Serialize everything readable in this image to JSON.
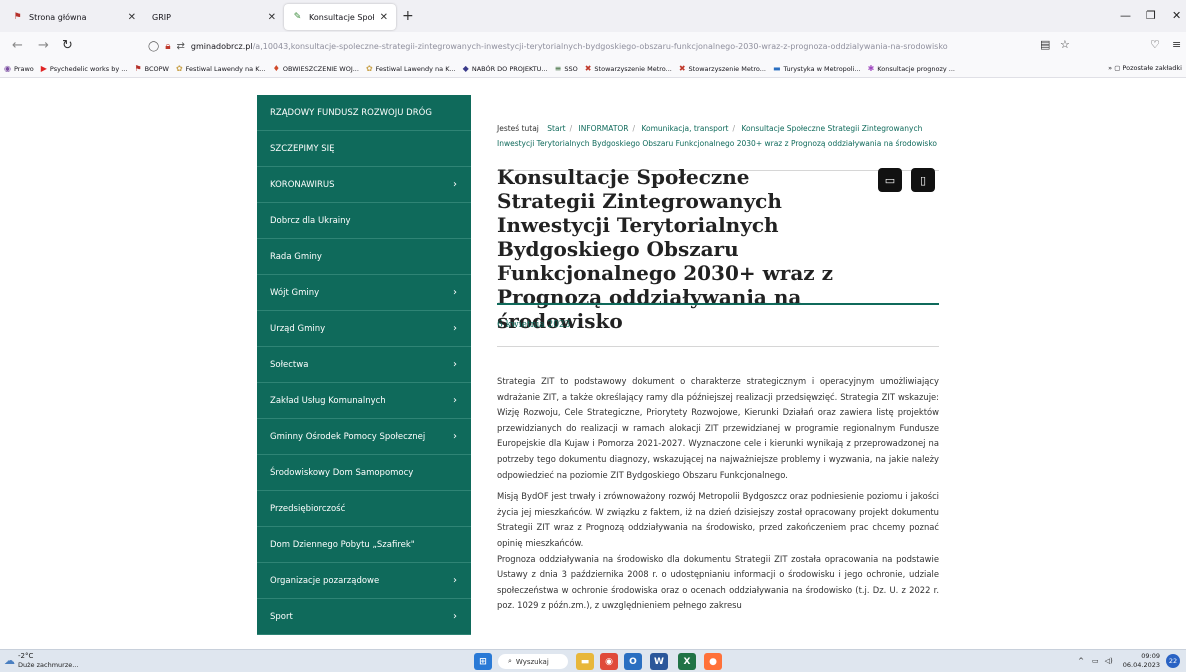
{
  "browser": {
    "tabs": [
      {
        "title": "Strona główna",
        "icon": "flag-favicon-icon"
      },
      {
        "title": "GRIP",
        "icon": "blank-favicon-icon"
      },
      {
        "title": "Konsultacje Społeczne Strategi",
        "icon": "gmina-favicon-icon"
      }
    ],
    "url_domain": "gminadobrcz.pl",
    "url_path": "/a,10043,konsultacje-spoleczne-strategii-zintegrowanych-inwestycji-terytorialnych-bydgoskiego-obszaru-funkcjonalnego-2030-wraz-z-prognoza-oddzialywania-na-srodowisko",
    "bookmarks": [
      "Prawo",
      "Psychedelic works by ...",
      "BCOPW",
      "Festiwal Lawendy na K...",
      "OBWIESZCZENIE WOJ...",
      "Festiwal Lawendy na K...",
      "NABÓR DO PROJEKTU...",
      "SSO",
      "Stowarzyszenie Metro...",
      "Stowarzyszenie Metro...",
      "Turystyka w Metropoli...",
      "Konsultacje prognozy ..."
    ],
    "bookmarks_other": "Pozostałe zakładki"
  },
  "sidebar": {
    "items": [
      {
        "label": "RZĄDOWY FUNDUSZ ROZWOJU DRÓG",
        "has_children": false
      },
      {
        "label": "SZCZEPIMY SIĘ",
        "has_children": false
      },
      {
        "label": "KORONAWIRUS",
        "has_children": true
      },
      {
        "label": "Dobrcz dla Ukrainy",
        "has_children": false
      },
      {
        "label": "Rada Gminy",
        "has_children": false
      },
      {
        "label": "Wójt Gminy",
        "has_children": true
      },
      {
        "label": "Urząd Gminy",
        "has_children": true
      },
      {
        "label": "Sołectwa",
        "has_children": true
      },
      {
        "label": "Zakład Usług Komunalnych",
        "has_children": true
      },
      {
        "label": "Gminny Ośrodek Pomocy Społecznej",
        "has_children": true
      },
      {
        "label": "Środowiskowy Dom Samopomocy",
        "has_children": false
      },
      {
        "label": "Przedsiębiorczość",
        "has_children": false
      },
      {
        "label": "Dom Dziennego Pobytu „Szafirek\"",
        "has_children": false
      },
      {
        "label": "Organizacje pozarządowe",
        "has_children": true
      },
      {
        "label": "Sport",
        "has_children": true
      }
    ]
  },
  "breadcrumb": {
    "here": "Jesteś tutaj",
    "items": [
      "Start",
      "INFORMATOR",
      "Komunikacja, transport",
      "Konsultacje Społeczne Strategii Zintegrowanych Inwestycji Terytorialnych Bydgoskiego Obszaru Funkcjonalnego 2030+ wraz z Prognozą oddziaływania na środowisko"
    ]
  },
  "article": {
    "title": "Konsultacje Społeczne Strategii Zintegrowanych Inwestycji Terytorialnych Bydgoskiego Obszaru Funkcjonalnego 2030+ wraz z Prognozą oddziaływania na środowisko",
    "date": "6 kwietnia 2023",
    "paragraphs": [
      "Strategia ZIT to podstawowy dokument o charakterze strategicznym i operacyjnym umożliwiający wdrażanie ZIT, a także określający ramy dla późniejszej realizacji przedsięwzięć. Strategia ZIT wskazuje: Wizję Rozwoju, Cele Strategiczne, Priorytety Rozwojowe, Kierunki Działań oraz zawiera listę projektów przewidzianych do realizacji w ramach alokacji ZIT przewidzianej w programie regionalnym Fundusze Europejskie dla Kujaw i Pomorza 2021-2027. Wyznaczone cele i kierunki wynikają z przeprowadzonej na potrzeby tego dokumentu diagnozy, wskazującej na najważniejsze problemy i wyzwania, na jakie należy odpowiedzieć na poziomie ZIT Bydgoskiego Obszaru Funkcjonalnego.",
      "Misją BydOF jest trwały i zrównoważony rozwój Metropolii Bydgoszcz oraz podniesienie poziomu i jakości życia jej mieszkańców. W związku z faktem, iż na dzień dzisiejszy został opracowany projekt dokumentu Strategii ZIT wraz z Prognozą oddziaływania na środowisko, przed zakończeniem prac chcemy poznać opinię mieszkańców.",
      "Prognoza oddziaływania na środowisko dla dokumentu Strategii ZIT została opracowania na podstawie Ustawy z dnia 3 października 2008 r. o udostępnianiu informacji o środowisku i jego ochronie, udziale społeczeństwa w ochronie środowiska oraz o ocenach oddziaływania na środowisko (t.j. Dz. U. z 2022 r. poz. 1029 z późn.zm.), z uwzględnieniem pełnego zakresu"
    ]
  },
  "taskbar": {
    "temp": "-2°C",
    "weather": "Duże zachmurze...",
    "search": "Wyszukaj",
    "time": "09:09",
    "date": "06.04.2023",
    "notifications": "22"
  },
  "colors": {
    "sidebar_bg": "#0f6a5b",
    "accent": "#0f6a5b"
  }
}
